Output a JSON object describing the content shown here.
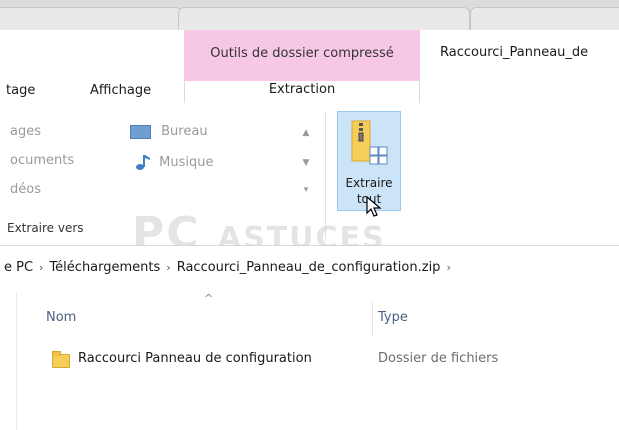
{
  "context_tab_title": "Outils de dossier compressé",
  "window_title": "Raccourci_Panneau_de",
  "ribbon_tabs": {
    "partage_partial": "tage",
    "affichage": "Affichage",
    "extraction": "Extraction"
  },
  "extract_to": {
    "left_column": [
      "ages",
      "ocuments",
      "déos"
    ],
    "right_column": [
      "Bureau",
      "Musique"
    ],
    "group_label": "Extraire vers"
  },
  "extract_all": {
    "line1": "Extraire",
    "line2": "tout"
  },
  "breadcrumb": [
    "e PC",
    "Téléchargements",
    "Raccourci_Panneau_de_configuration.zip"
  ],
  "columns": {
    "name": "Nom",
    "type": "Type"
  },
  "files": [
    {
      "name": "Raccourci Panneau de configuration",
      "type": "Dossier de fichiers"
    }
  ],
  "watermark": {
    "big": "PC",
    "small": "ASTUCES"
  },
  "colors": {
    "context_tab": "#f6c8e6",
    "selected_button": "#cce4f7",
    "folder": "#f6cd58"
  },
  "icons": [
    "desktop-icon",
    "music-icon",
    "zip-folder-icon",
    "folder-icon",
    "cursor-icon"
  ]
}
